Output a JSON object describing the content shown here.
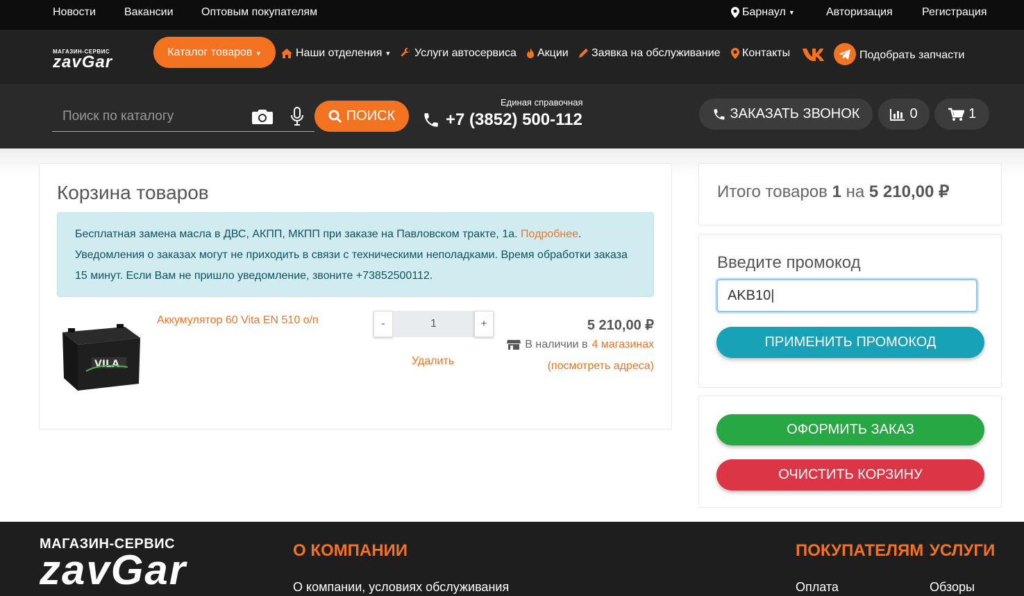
{
  "topbar": {
    "news": "Новости",
    "jobs": "Вакансии",
    "wholesale": "Оптовым покупателям",
    "city": "Барнаул",
    "login": "Авторизация",
    "register": "Регистрация"
  },
  "nav": {
    "logo_top": "МАГАЗИН-СЕРВИС",
    "logo_main": "zavGar",
    "catalog": "Каталог товаров",
    "branches": "Наши отделения",
    "services": "Услуги автосервиса",
    "promo": "Акции",
    "service_request": "Заявка на обслуживание",
    "contacts": "Контакты",
    "parts": "Подобрать запчасти"
  },
  "search": {
    "placeholder": "Поиск по каталогу",
    "button": "ПОИСК",
    "phone_caption": "Единая справочная",
    "phone": "+7 (3852) 500-112",
    "callback": "ЗАКАЗАТЬ ЗВОНОК",
    "compare_count": "0",
    "cart_count": "1"
  },
  "cart": {
    "title": "Корзина товаров",
    "notice_line1": "Бесплатная замена масла в ДВС, АКПП, МКПП при заказе на Павловском тракте, 1а.",
    "notice_link": "Подробнее",
    "notice_line2": "Уведомления о заказах могут не приходить в связи с техническими неполадками. Время обработки заказа 15 минут. Если Вам не пришло уведомление, звоните +73852500112.",
    "item": {
      "name": "Аккумулятор 60 Vita EN 510 о/п",
      "qty": "1",
      "minus": "-",
      "plus": "+",
      "delete": "Удалить",
      "price": "5 210,00 ₽",
      "stock_prefix": "В наличии в",
      "stock_link": "4 магазинах",
      "addresses": "(посмотреть адреса)"
    }
  },
  "summary": {
    "prefix": "Итого товаров",
    "count": "1",
    "mid": "на",
    "sum": "5 210,00 ₽"
  },
  "promo": {
    "label": "Введите промокод",
    "value": "AKB10",
    "apply": "ПРИМЕНИТЬ ПРОМОКОД"
  },
  "actions": {
    "checkout": "ОФОРМИТЬ ЗАКАЗ",
    "clear": "ОЧИСТИТЬ КОРЗИНУ"
  },
  "footer": {
    "logo_top": "МАГАЗИН-СЕРВИС",
    "logo_main": "zavGar",
    "about_head": "О КОМПАНИИ",
    "about_link": "О компании, условиях обслуживания",
    "buyers_head": "ПОКУПАТЕЛЯМ",
    "buyers_link": "Оплата",
    "services_head": "УСЛУГИ",
    "services_link": "Обзоры"
  },
  "colors": {
    "accent": "#f47321",
    "apply": "#17a2b8",
    "checkout": "#28a745",
    "clear": "#dc3545",
    "notice_bg": "#d1ecf1"
  }
}
